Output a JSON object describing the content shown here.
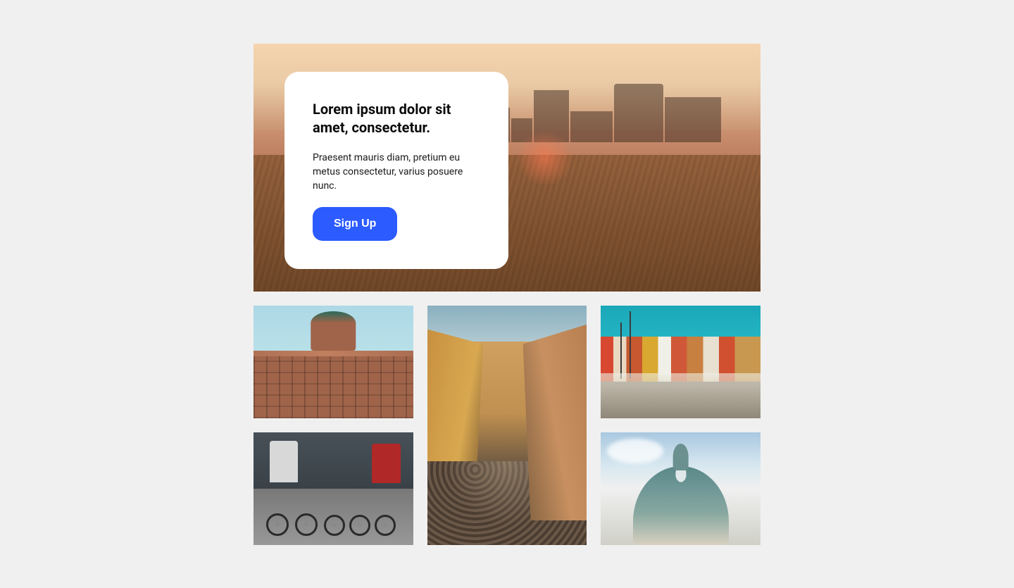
{
  "hero": {
    "title": "Lorem ipsum dolor sit amet, consectetur.",
    "subtitle": "Praesent mauris diam, pretium eu metus consectetur, varius posuere nunc.",
    "button_label": "Sign Up"
  }
}
